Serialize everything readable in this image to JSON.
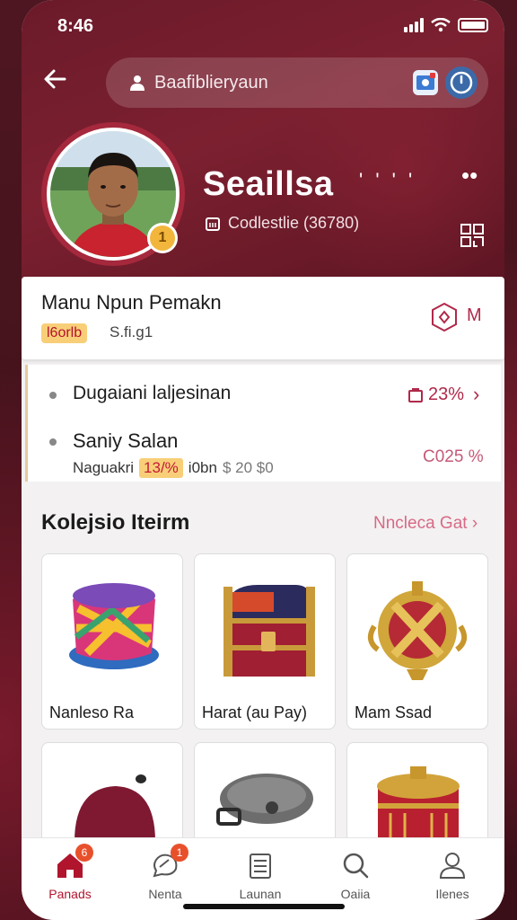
{
  "status": {
    "time": "8:46"
  },
  "header": {
    "search_text": "Baafiblieryaun"
  },
  "profile": {
    "name": "Seaillsa",
    "name_suffix": "' ' ' '",
    "subtitle": "Codlestlie (36780)",
    "badge": "1"
  },
  "player_card": {
    "title": "Manu Npun Pemakn",
    "tag": "l6orlb",
    "meta": "S.fi.g1",
    "right_letter": "M"
  },
  "stats": {
    "row1": {
      "label": "Dugaiani laljesinan",
      "value": "23%"
    },
    "row2": {
      "label": "Saniy Salan",
      "sub_prefix": "Naguakri",
      "chip": "13/%",
      "sub_mid": "i0bn",
      "price": "$ 20 $0",
      "value": "C025 %"
    }
  },
  "collection": {
    "title": "Kolejsio Iteirm",
    "link": "Nncleca Gat",
    "items": [
      {
        "label": "Nanleso Ra",
        "icon": "bucket-hat-icon"
      },
      {
        "label": "Harat (au Pay)",
        "icon": "treasure-chest-icon"
      },
      {
        "label": "Mam Ssad",
        "icon": "golden-orb-icon"
      },
      {
        "label": "",
        "icon": "maroon-cap-icon"
      },
      {
        "label": "",
        "icon": "grey-beret-icon"
      },
      {
        "label": "",
        "icon": "drum-icon"
      }
    ]
  },
  "nav": {
    "items": [
      {
        "label": "Panads",
        "icon": "home-icon",
        "badge": "6",
        "active": true
      },
      {
        "label": "Nenta",
        "icon": "chat-icon",
        "badge": "1"
      },
      {
        "label": "Launan",
        "icon": "document-icon"
      },
      {
        "label": "Oaiia",
        "icon": "search-icon"
      },
      {
        "label": "Ilenes",
        "icon": "profile-icon"
      }
    ]
  },
  "colors": {
    "accent": "#b0152d",
    "hero": "#6b1a2a",
    "chip": "#f8cf78"
  }
}
